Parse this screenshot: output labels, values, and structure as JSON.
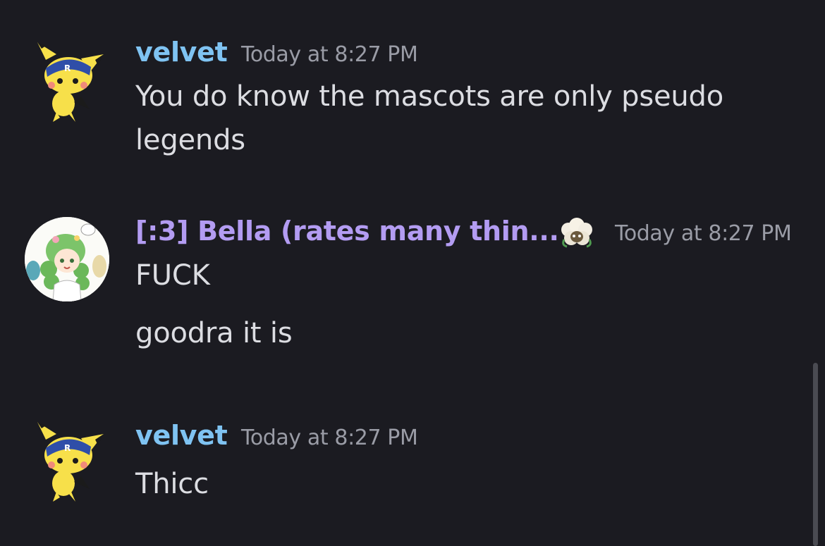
{
  "messages": [
    {
      "author": "velvet",
      "author_color": "#7fc3f2",
      "avatar": "pichu-avatar",
      "timestamp": "Today at 8:27 PM",
      "lines": [
        "You do know the mascots are only pseudo",
        "legends"
      ]
    },
    {
      "author": "[:3] Bella (rates many thin...",
      "author_color": "#b39cf2",
      "avatar": "anime-girl-avatar",
      "badge_icon": "whimsicott-icon",
      "timestamp": "Today at 8:27 PM",
      "lines": [
        "FUCK",
        "goodra it is"
      ]
    },
    {
      "author": "velvet",
      "author_color": "#7fc3f2",
      "avatar": "pichu-avatar",
      "timestamp": "Today at 8:27 PM",
      "lines": [
        "Thicc"
      ]
    }
  ],
  "colors": {
    "background": "#1b1b21",
    "text": "#dcdde2",
    "timestamp": "#9a9ca6",
    "scrollbar": "#4a4b52"
  }
}
